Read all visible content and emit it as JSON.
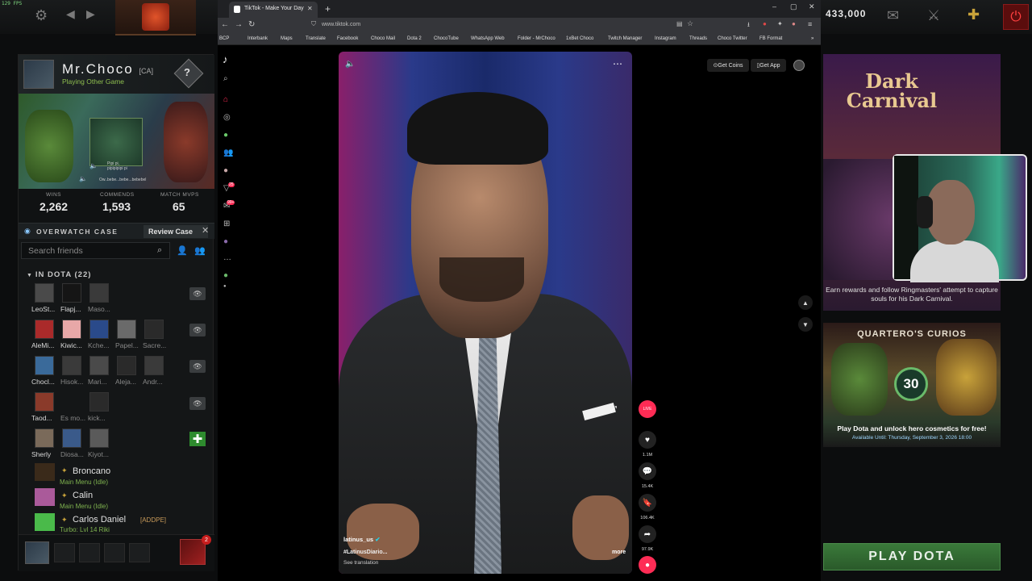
{
  "dota": {
    "fps": "129 FPS",
    "gold": "433,000",
    "profile": {
      "name": "Mr.Choco",
      "tag": "[CA]",
      "status": "Playing Other Game",
      "sound_line1": "Pipi pi,",
      "sound_line2": "pipipipipi pi",
      "sound_line3": "Ow..bebe...bebe...bebebel"
    },
    "stats": [
      {
        "label": "WINS",
        "value": "2,262"
      },
      {
        "label": "COMMENDS",
        "value": "1,593"
      },
      {
        "label": "MATCH MVPS",
        "value": "65"
      }
    ],
    "overwatch": {
      "label": "OVERWATCH CASE",
      "button": "Review Case"
    },
    "search_placeholder": "Search friends",
    "in_dota_header": "IN DOTA (22)",
    "friend_rows": [
      {
        "names": [
          "LeoSt...",
          "Flapj...",
          "Maso..."
        ]
      },
      {
        "names": [
          "AleMi...",
          "Kiwic...",
          "Kche...",
          "Papel...",
          "Sacre..."
        ]
      },
      {
        "names": [
          "Chocl...",
          "Hisok...",
          "Mari...",
          "Aleja...",
          "Andr..."
        ]
      },
      {
        "names": [
          "Taod...",
          "Es mo...",
          "kick..."
        ]
      },
      {
        "names": [
          "Sherly",
          "Diosa...",
          "Kiyot..."
        ]
      }
    ],
    "friend_list": [
      {
        "name": "Broncano",
        "status": "Main Menu (Idle)",
        "tag": ""
      },
      {
        "name": "Calin",
        "status": "Main Menu (Idle)",
        "tag": ""
      },
      {
        "name": "Carlos Daniel",
        "status": "Turbo: Lvl 14 Riki",
        "tag": "[ADDPE]"
      }
    ],
    "chat_badge": "2",
    "event": {
      "title_line1": "Dark",
      "title_line2": "Carnival",
      "desc": "Earn rewards and follow Ringmasters' attempt to capture souls for his Dark Carnival."
    },
    "curios": {
      "title": "QUARTERO'S CURIOS",
      "badge": "30",
      "desc": "Play Dota and unlock hero cosmetics for free!",
      "available": "Available Until:  Thursday, September 3, 2026 18:00"
    },
    "play_button": "PLAY DOTA"
  },
  "browser": {
    "tab_title": "TikTok - Make Your Day",
    "url": "www.tiktok.com",
    "bookmarks": [
      "BCP",
      "Interbank",
      "Maps",
      "Translate",
      "Facebook",
      "Choco Mail",
      "Dota 2",
      "ChocoTube",
      "WhatsApp Web",
      "Folder - MrChoco",
      "1xBet Choco",
      "Twitch Manager",
      "Instagram",
      "Threads",
      "Choco Twitter",
      "FB Format"
    ]
  },
  "tiktok": {
    "get_coins": "Get Coins",
    "get_app": "Get App",
    "sidebar_badge1": "25",
    "sidebar_badge2": "99+",
    "author": "latinus_us",
    "hashtag": "#LatinusDiario...",
    "see_translation": "See translation",
    "more": "more",
    "likes": "1.1M",
    "comments": "15.4K",
    "saves": "106.4K",
    "shares": "97.9K",
    "live_label": "LIVE"
  },
  "colors": {
    "accent_play": "#3a7a3a",
    "tiktok_bg": "#000000",
    "status_green": "#7fb34f"
  }
}
